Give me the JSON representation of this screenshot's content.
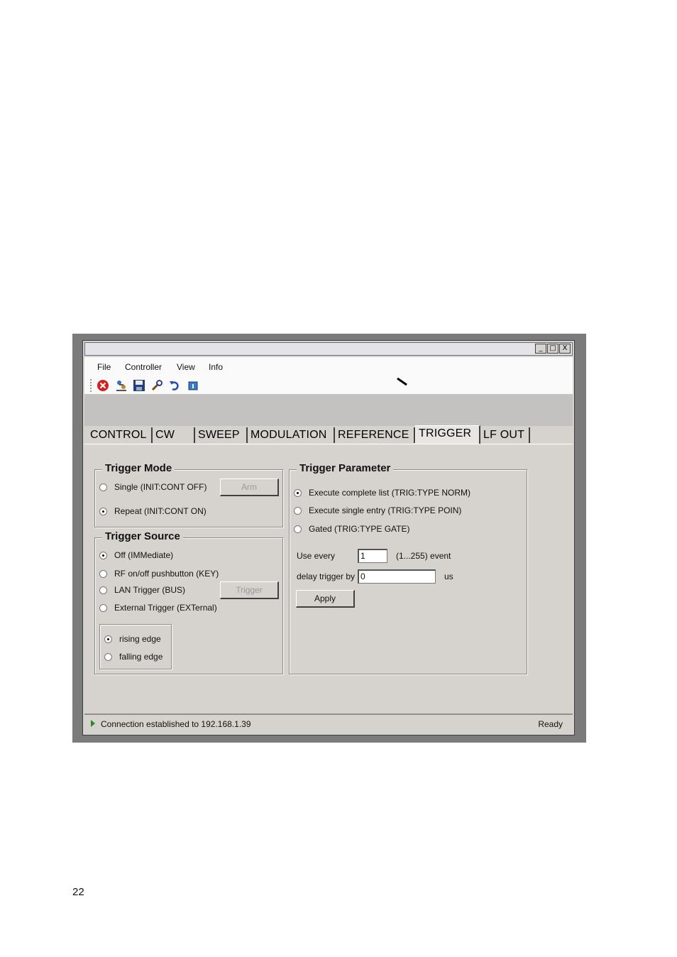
{
  "window": {
    "min_btn": "_",
    "max_btn": "□",
    "close_btn": "X"
  },
  "menu": [
    "File",
    "Controller",
    "View",
    "Info"
  ],
  "toolbar_icons": [
    "stop-icon",
    "connect-icon",
    "save-icon",
    "wrench-icon",
    "undo-icon",
    "info-icon"
  ],
  "tabs": [
    "CONTROL",
    "CW",
    "SWEEP",
    "MODULATION",
    "REFERENCE",
    "TRIGGER",
    "LF OUT"
  ],
  "active_tab": "TRIGGER",
  "trigger_mode": {
    "title": "Trigger Mode",
    "single": "Single (INIT:CONT OFF)",
    "repeat": "Repeat (INIT:CONT ON)",
    "arm_button": "Arm",
    "selected": "repeat"
  },
  "trigger_source": {
    "title": "Trigger Source",
    "off": "Off (IMMediate)",
    "rf": "RF on/off pushbutton (KEY)",
    "lan": "LAN Trigger (BUS)",
    "external": "External Trigger (EXTernal)",
    "trigger_button": "Trigger",
    "selected": "off",
    "rising": "rising edge",
    "falling": "falling edge",
    "edge_selected": "rising"
  },
  "trigger_parameter": {
    "title": "Trigger Parameter",
    "complete": "Execute complete list (TRIG:TYPE NORM)",
    "single": "Execute single entry (TRIG:TYPE POIN)",
    "gated": "Gated (TRIG:TYPE GATE)",
    "selected": "complete",
    "use_every_label": "Use every",
    "use_every_value": "1",
    "use_every_range": "(1...255) event",
    "delay_label": "delay trigger by",
    "delay_value": "0",
    "delay_unit": "us",
    "apply_button": "Apply"
  },
  "status": {
    "message": "Connection established to 192.168.1.39",
    "state": "Ready"
  },
  "page_number": "22",
  "colors": {
    "frame": "#7b7b7b",
    "window_bg": "#d6d3ce",
    "menubar_bg": "#fafafa",
    "grey_band": "#c4c2c0",
    "status_arrow": "#2a8a2a"
  }
}
